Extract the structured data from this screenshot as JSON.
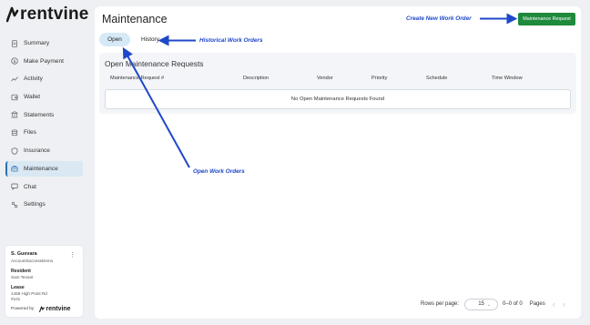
{
  "brand": {
    "name": "rentvine"
  },
  "nav": [
    {
      "label": "Summary",
      "icon": "document-icon"
    },
    {
      "label": "Make Payment",
      "icon": "dollar-circle-icon"
    },
    {
      "label": "Activity",
      "icon": "activity-line-icon"
    },
    {
      "label": "Wallet",
      "icon": "wallet-icon"
    },
    {
      "label": "Statements",
      "icon": "bank-icon"
    },
    {
      "label": "Files",
      "icon": "files-icon"
    },
    {
      "label": "Insurance",
      "icon": "shield-icon"
    },
    {
      "label": "Maintenance",
      "icon": "toolbox-icon",
      "active": true
    },
    {
      "label": "Chat",
      "icon": "chat-icon"
    },
    {
      "label": "Settings",
      "icon": "settings-icon"
    }
  ],
  "user_card": {
    "name": "S. Guevara",
    "account": "AccountSuccessDemo",
    "resident_label": "Resident",
    "resident": "Sam Tenant",
    "lease_label": "Lease",
    "lease_line1": "1458 High Point Rd",
    "lease_line2": "#101",
    "powered_by": "Powered by",
    "powered_brand": "rentvine"
  },
  "main": {
    "title": "Maintenance",
    "request_button": "Maintenance Request",
    "tabs": [
      {
        "label": "Open",
        "active": true
      },
      {
        "label": "History",
        "active": false
      }
    ],
    "panel_title": "Open Maintenance Requests",
    "columns": [
      "Maintenance Request #",
      "Description",
      "Vendor",
      "Priority",
      "Schedule",
      "Time Window"
    ],
    "empty_message": "No Open Maintenance Requests Found",
    "pagination": {
      "rows_per_page_label": "Rows per page:",
      "rows_per_page": "15",
      "range": "0–0 of 0",
      "pages_label": "Pages"
    }
  },
  "annotations": {
    "create": "Create New Work Order",
    "history": "Historical Work Orders",
    "open": "Open Work Orders",
    "color": "#1f48c9"
  },
  "colors": {
    "accent_green": "#1e8a3c",
    "active_blue": "#d9e8f3",
    "tab_active": "#d6e9f6"
  }
}
